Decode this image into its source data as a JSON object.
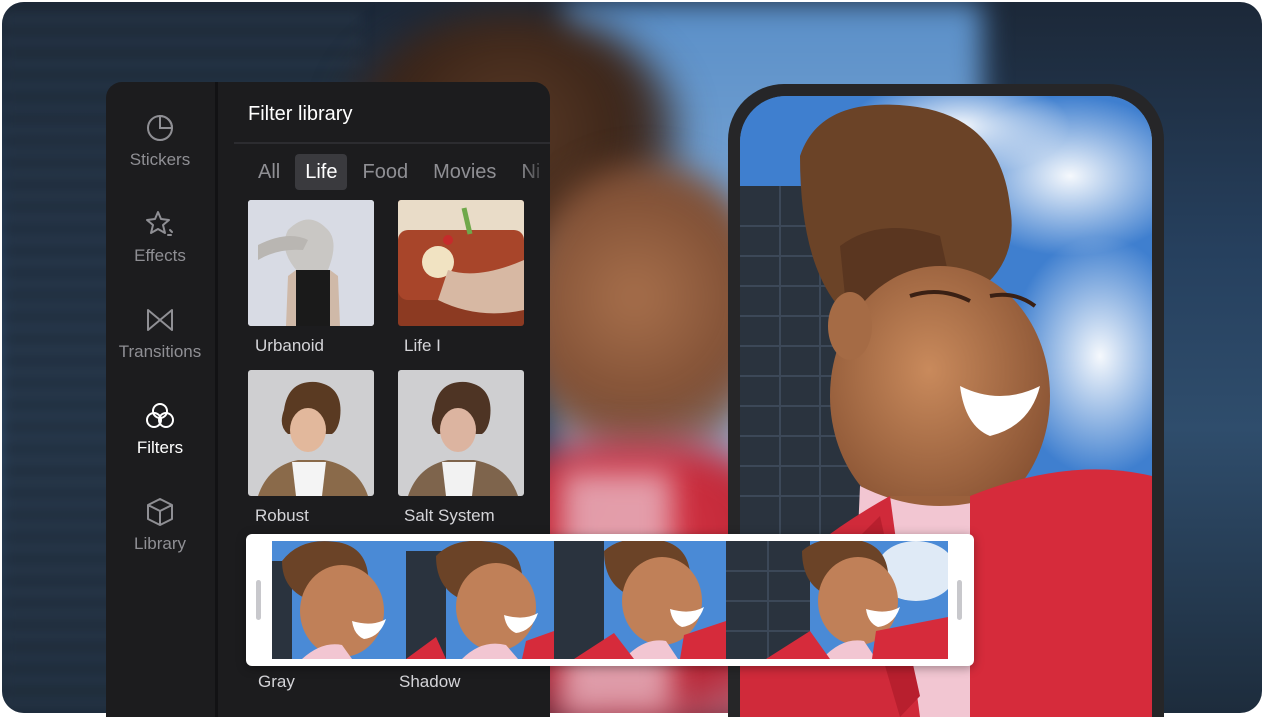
{
  "sidebar": {
    "items": [
      {
        "label": "Stickers",
        "icon": "stickers-icon"
      },
      {
        "label": "Effects",
        "icon": "effects-icon"
      },
      {
        "label": "Transitions",
        "icon": "transitions-icon"
      },
      {
        "label": "Filters",
        "icon": "filters-icon",
        "active": true
      },
      {
        "label": "Library",
        "icon": "library-icon"
      }
    ]
  },
  "library": {
    "title": "Filter library",
    "tabs": [
      "All",
      "Life",
      "Food",
      "Movies",
      "Ni"
    ],
    "active_tab": "Life",
    "filters": [
      {
        "name": "Urbanoid"
      },
      {
        "name": "Life I"
      },
      {
        "name": "Robust"
      },
      {
        "name": "Salt System"
      },
      {
        "name": "Gray"
      },
      {
        "name": "Shadow"
      }
    ]
  },
  "colors": {
    "panel_bg": "#1c1c1e",
    "accent_red": "#d62b3b",
    "sky_blue": "#4f8ed6"
  }
}
